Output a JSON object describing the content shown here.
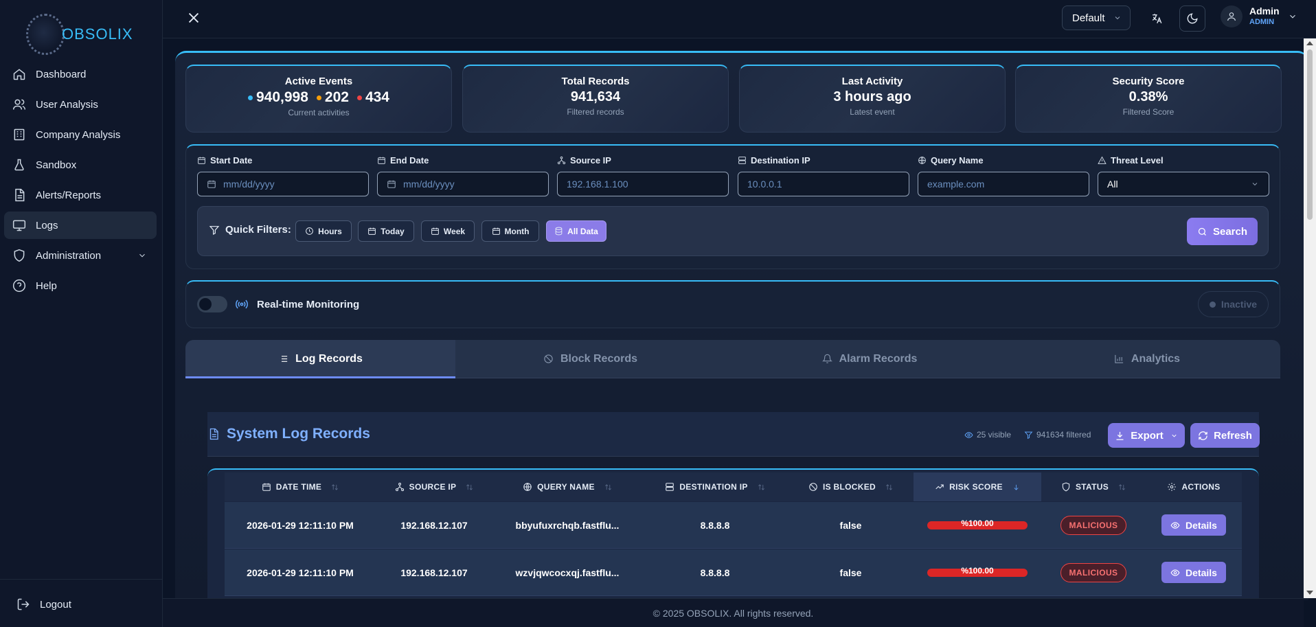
{
  "brand": {
    "name": "OBSOLIX"
  },
  "sidebar": {
    "items": [
      {
        "label": "Dashboard",
        "icon": "home-icon"
      },
      {
        "label": "User Analysis",
        "icon": "users-icon"
      },
      {
        "label": "Company Analysis",
        "icon": "building-icon"
      },
      {
        "label": "Sandbox",
        "icon": "flask-icon"
      },
      {
        "label": "Alerts/Reports",
        "icon": "document-icon"
      },
      {
        "label": "Logs",
        "icon": "monitor-icon",
        "active": true
      },
      {
        "label": "Administration",
        "icon": "shield-icon"
      },
      {
        "label": "Help",
        "icon": "help-icon"
      }
    ],
    "logout": "Logout"
  },
  "topbar": {
    "theme_select": "Default",
    "user_name": "Admin",
    "user_role": "ADMIN"
  },
  "stats": {
    "active_events": {
      "title": "Active Events",
      "blue": "940,998",
      "amber": "202",
      "red": "434",
      "sub": "Current activities"
    },
    "total_records": {
      "title": "Total Records",
      "value": "941,634",
      "sub": "Filtered records"
    },
    "last_activity": {
      "title": "Last Activity",
      "value": "3 hours ago",
      "sub": "Latest event"
    },
    "security_score": {
      "title": "Security Score",
      "value": "0.38%",
      "sub": "Filtered Score"
    }
  },
  "filters": {
    "start_date": {
      "label": "Start Date",
      "placeholder": "mm/dd/yyyy"
    },
    "end_date": {
      "label": "End Date",
      "placeholder": "mm/dd/yyyy"
    },
    "source_ip": {
      "label": "Source IP",
      "placeholder": "192.168.1.100"
    },
    "destination_ip": {
      "label": "Destination IP",
      "placeholder": "10.0.0.1"
    },
    "query_name": {
      "label": "Query Name",
      "placeholder": "example.com"
    },
    "threat_level": {
      "label": "Threat Level",
      "value": "All"
    }
  },
  "quick_filters": {
    "label": "Quick Filters:",
    "hours": "Hours",
    "today": "Today",
    "week": "Week",
    "month": "Month",
    "all_data": "All Data",
    "search": "Search"
  },
  "realtime": {
    "label": "Real-time Monitoring",
    "status": "Inactive"
  },
  "tabs": [
    "Log Records",
    "Block Records",
    "Alarm Records",
    "Analytics"
  ],
  "logs": {
    "title": "System Log Records",
    "visible": "25 visible",
    "filtered": "941634 filtered",
    "export": "Export",
    "refresh": "Refresh"
  },
  "table": {
    "headers": [
      "DATE TIME",
      "SOURCE IP",
      "QUERY NAME",
      "DESTINATION IP",
      "IS BLOCKED",
      "RISK SCORE",
      "STATUS",
      "ACTIONS"
    ],
    "rows": [
      {
        "datetime": "2026-01-29 12:11:10 PM",
        "source_ip": "192.168.12.107",
        "query": "bbyufuxrchqb.fastflu...",
        "dest_ip": "8.8.8.8",
        "blocked": "false",
        "risk": "%100.00",
        "risk_value": 100,
        "status": "MALICIOUS",
        "action": "Details"
      },
      {
        "datetime": "2026-01-29 12:11:10 PM",
        "source_ip": "192.168.12.107",
        "query": "wzvjqwcocxqj.fastflu...",
        "dest_ip": "8.8.8.8",
        "blocked": "false",
        "risk": "%100.00",
        "risk_value": 100,
        "status": "MALICIOUS",
        "action": "Details"
      }
    ]
  },
  "footer": "© 2025 OBSOLIX. All rights reserved.",
  "colors": {
    "accent": "#38bdf8",
    "primary_button": "#7c75e0",
    "danger": "#dc2626",
    "dot_blue": "#38bdf8",
    "dot_amber": "#f59e0b",
    "dot_red": "#ef4444"
  }
}
